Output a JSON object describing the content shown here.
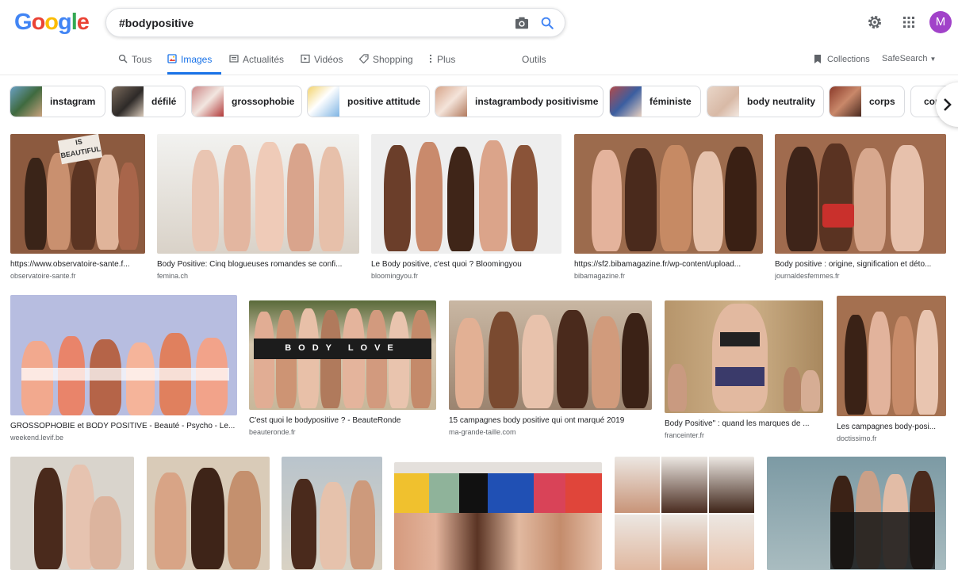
{
  "logo": {
    "letters": [
      "G",
      "o",
      "o",
      "g",
      "l",
      "e"
    ],
    "colors": [
      "#4285f4",
      "#ea4335",
      "#fbbc05",
      "#4285f4",
      "#34a853",
      "#ea4335"
    ]
  },
  "search": {
    "query": "#bodypositive"
  },
  "avatar": {
    "initial": "M",
    "color": "#a142c9"
  },
  "tabs": [
    {
      "label": "Tous",
      "icon": "search-icon"
    },
    {
      "label": "Images",
      "icon": "image-icon",
      "active": true
    },
    {
      "label": "Actualités",
      "icon": "news-icon"
    },
    {
      "label": "Vidéos",
      "icon": "video-icon"
    },
    {
      "label": "Shopping",
      "icon": "tag-icon"
    },
    {
      "label": "Plus",
      "icon": "more-vert-icon"
    },
    {
      "label": "Outils"
    }
  ],
  "toolbar": {
    "collections": "Collections",
    "safesearch": "SafeSearch"
  },
  "chips": [
    {
      "label": "instagram"
    },
    {
      "label": "défilé"
    },
    {
      "label": "grossophobie"
    },
    {
      "label": "positive attitude"
    },
    {
      "label": "instagrambody positivisme"
    },
    {
      "label": "féministe"
    },
    {
      "label": "body neutrality"
    },
    {
      "label": "corps"
    },
    {
      "label": "cor"
    }
  ],
  "results": [
    {
      "title": "https://www.observatoire-sante.f...",
      "source": "observatoire-sante.fr"
    },
    {
      "title": "Body Positive: Cinq blogueuses romandes se confi...",
      "source": "femina.ch"
    },
    {
      "title": "Le Body positive, c'est quoi ? Bloomingyou",
      "source": "bloomingyou.fr"
    },
    {
      "title": "https://sf2.bibamagazine.fr/wp-content/upload...",
      "source": "bibamagazine.fr"
    },
    {
      "title": "Body positive : origine, signification et déto...",
      "source": "journaldesfemmes.fr"
    },
    {
      "title": "GROSSOPHOBIE et BODY POSITIVE - Beauté - Psycho - Le...",
      "source": "weekend.levif.be"
    },
    {
      "title": "C'est quoi le bodypositive ? - BeauteRonde",
      "source": "beauteronde.fr"
    },
    {
      "title": "15 campagnes body positive qui ont marqué 2019",
      "source": "ma-grande-taille.com"
    },
    {
      "title": "Body Positive\" : quand les marques de ...",
      "source": "franceinter.fr"
    },
    {
      "title": "Les campagnes body-posi...",
      "source": "doctissimo.fr"
    },
    {
      "title": "",
      "source": ""
    },
    {
      "title": "",
      "source": ""
    },
    {
      "title": "",
      "source": ""
    },
    {
      "title": "",
      "source": ""
    },
    {
      "title": "",
      "source": ""
    },
    {
      "title": "",
      "source": ""
    }
  ],
  "image_overlays": {
    "sign": "IS\nBEAUTIFUL",
    "body_love": "BODY LOVE"
  }
}
